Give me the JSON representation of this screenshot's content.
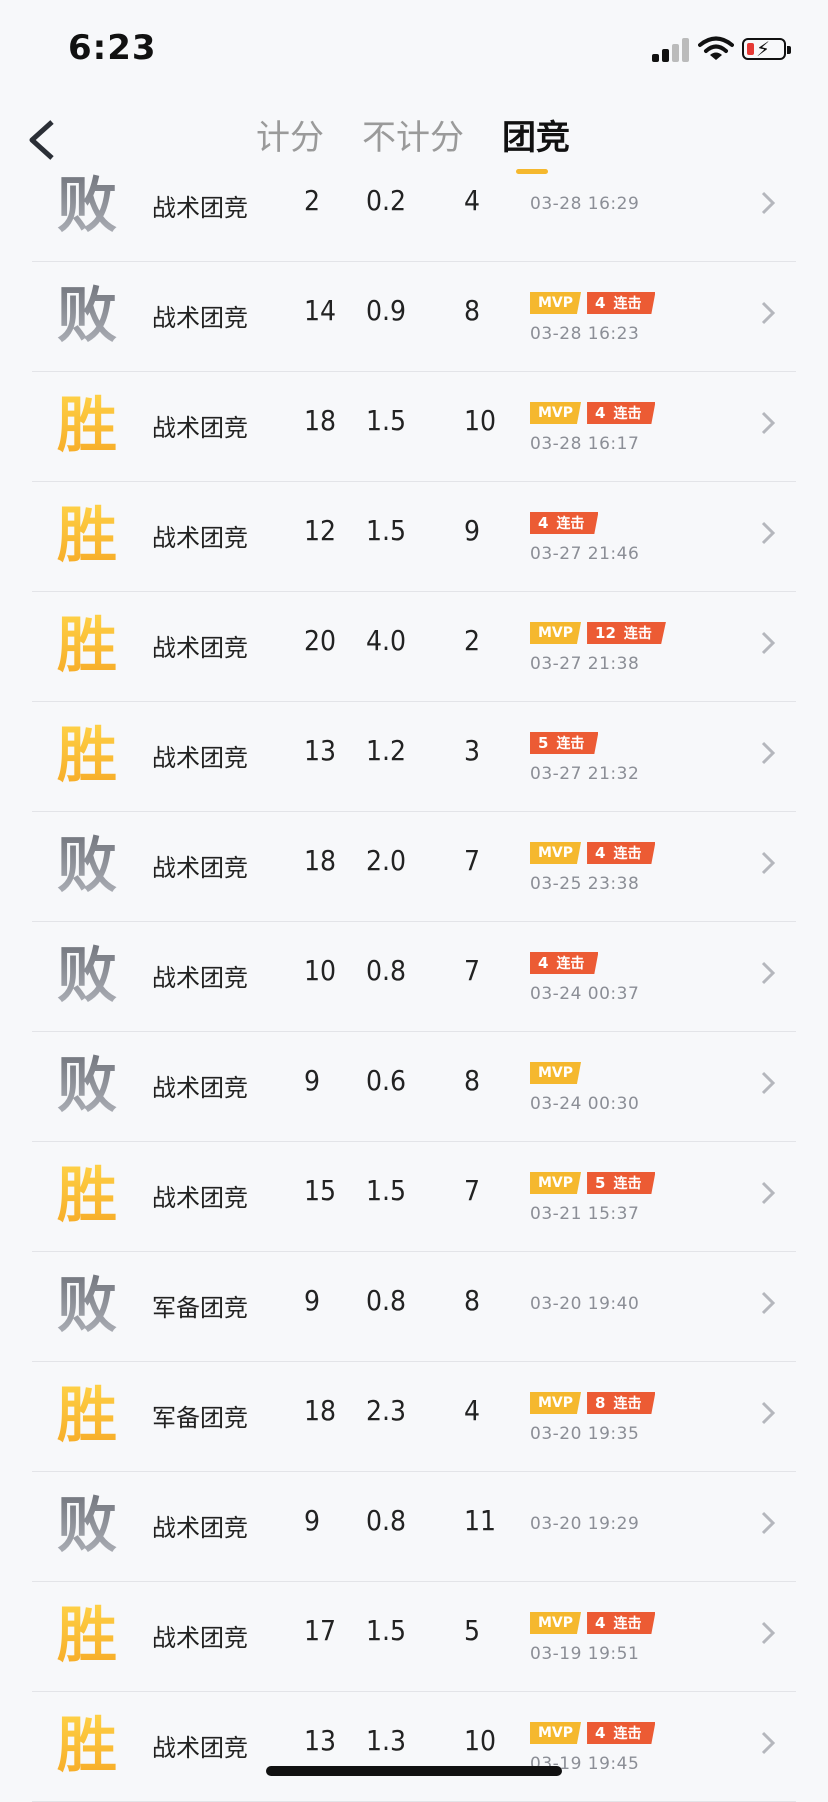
{
  "status_bar": {
    "time": "6:23"
  },
  "nav": {
    "tabs": [
      {
        "label": "计分",
        "active": false
      },
      {
        "label": "不计分",
        "active": false
      },
      {
        "label": "团竞",
        "active": true
      }
    ]
  },
  "colors": {
    "accent": "#f5b82e",
    "streak": "#ec5b34",
    "win": "#f7c230",
    "lose": "#8a8d94"
  },
  "matches": [
    {
      "result": "败",
      "mode": "战术团竞",
      "kills": "2",
      "kd": "0.2",
      "deaths": "4",
      "mvp": "",
      "streak": "",
      "streak_label": "",
      "date": "03-28 16:29"
    },
    {
      "result": "败",
      "mode": "战术团竞",
      "kills": "14",
      "kd": "0.9",
      "deaths": "8",
      "mvp": "MVP",
      "streak": "4",
      "streak_label": "连击",
      "date": "03-28 16:23"
    },
    {
      "result": "胜",
      "mode": "战术团竞",
      "kills": "18",
      "kd": "1.5",
      "deaths": "10",
      "mvp": "MVP",
      "streak": "4",
      "streak_label": "连击",
      "date": "03-28 16:17"
    },
    {
      "result": "胜",
      "mode": "战术团竞",
      "kills": "12",
      "kd": "1.5",
      "deaths": "9",
      "mvp": "",
      "streak": "4",
      "streak_label": "连击",
      "date": "03-27 21:46"
    },
    {
      "result": "胜",
      "mode": "战术团竞",
      "kills": "20",
      "kd": "4.0",
      "deaths": "2",
      "mvp": "MVP",
      "streak": "12",
      "streak_label": "连击",
      "date": "03-27 21:38"
    },
    {
      "result": "胜",
      "mode": "战术团竞",
      "kills": "13",
      "kd": "1.2",
      "deaths": "3",
      "mvp": "",
      "streak": "5",
      "streak_label": "连击",
      "date": "03-27 21:32"
    },
    {
      "result": "败",
      "mode": "战术团竞",
      "kills": "18",
      "kd": "2.0",
      "deaths": "7",
      "mvp": "MVP",
      "streak": "4",
      "streak_label": "连击",
      "date": "03-25 23:38"
    },
    {
      "result": "败",
      "mode": "战术团竞",
      "kills": "10",
      "kd": "0.8",
      "deaths": "7",
      "mvp": "",
      "streak": "4",
      "streak_label": "连击",
      "date": "03-24 00:37"
    },
    {
      "result": "败",
      "mode": "战术团竞",
      "kills": "9",
      "kd": "0.6",
      "deaths": "8",
      "mvp": "MVP",
      "streak": "",
      "streak_label": "",
      "date": "03-24 00:30"
    },
    {
      "result": "胜",
      "mode": "战术团竞",
      "kills": "15",
      "kd": "1.5",
      "deaths": "7",
      "mvp": "MVP",
      "streak": "5",
      "streak_label": "连击",
      "date": "03-21 15:37"
    },
    {
      "result": "败",
      "mode": "军备团竞",
      "kills": "9",
      "kd": "0.8",
      "deaths": "8",
      "mvp": "",
      "streak": "",
      "streak_label": "",
      "date": "03-20 19:40"
    },
    {
      "result": "胜",
      "mode": "军备团竞",
      "kills": "18",
      "kd": "2.3",
      "deaths": "4",
      "mvp": "MVP",
      "streak": "8",
      "streak_label": "连击",
      "date": "03-20 19:35"
    },
    {
      "result": "败",
      "mode": "战术团竞",
      "kills": "9",
      "kd": "0.8",
      "deaths": "11",
      "mvp": "",
      "streak": "",
      "streak_label": "",
      "date": "03-20 19:29"
    },
    {
      "result": "胜",
      "mode": "战术团竞",
      "kills": "17",
      "kd": "1.5",
      "deaths": "5",
      "mvp": "MVP",
      "streak": "4",
      "streak_label": "连击",
      "date": "03-19 19:51"
    },
    {
      "result": "胜",
      "mode": "战术团竞",
      "kills": "13",
      "kd": "1.3",
      "deaths": "10",
      "mvp": "MVP",
      "streak": "4",
      "streak_label": "连击",
      "date": "03-19 19:45"
    }
  ]
}
